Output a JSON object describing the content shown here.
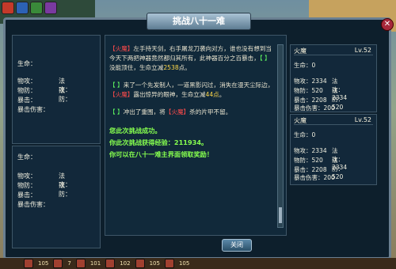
{
  "dialog": {
    "title": "挑战八十一难",
    "close_button": "关闭"
  },
  "left_panels": [
    {
      "hp_label": "生命：",
      "rows": [
        [
          "物攻：",
          "法攻："
        ],
        [
          "物防：",
          "法防："
        ],
        [
          "暴击：",
          ""
        ],
        [
          "暴击伤害：",
          ""
        ]
      ]
    },
    {
      "hp_label": "生命：",
      "rows": [
        [
          "物攻：",
          "法攻："
        ],
        [
          "物防：",
          "法防："
        ],
        [
          "暴击：",
          ""
        ],
        [
          "暴击伤害：",
          ""
        ]
      ]
    }
  ],
  "right_panels": [
    {
      "name": "火魔",
      "level": "Lv.52",
      "hp": "生命：0",
      "patk": "物攻：2334",
      "matk": "法攻：2334",
      "pdef": "物防：520",
      "mdef": "法防：520",
      "crit": "暴击：2208",
      "critdmg": "暴击伤害：200"
    },
    {
      "name": "火魔",
      "level": "Lv.52",
      "hp": "生命：0",
      "patk": "物攻：2334",
      "matk": "法攻：2334",
      "pdef": "物防：520",
      "mdef": "法防：520",
      "crit": "暴击：2208",
      "critdmg": "暴击伤害：200"
    }
  ],
  "battle_log": {
    "p1_a": "【火魔】",
    "p1_b": "左手持天剑，右手屠龙刀袭向对方，谁也没有想到当今天下两把神器竟然都归其所有，此神器百分之百暴击，",
    "p1_c": "【          】",
    "p1_d": "没能顶住，生命立减",
    "p1_e": "2538",
    "p1_f": "点。",
    "p2_a": "【          】",
    "p2_b": "来了一个先发制人，一道黑影闪过，消失在漫天尘际边，",
    "p2_c": "【火魔】",
    "p2_d": "露出惊异的眼神，生命立减",
    "p2_e": "44点",
    "p2_f": "。",
    "p3_a": "【          】",
    "p3_b": "冲出了重围，将",
    "p3_c": "【火魔】",
    "p3_d": "杀的片甲不留。",
    "result1": "您此次挑战成功。",
    "result2": "你此次挑战获得经验：211934。",
    "result3": "你可以在八十一难主界面领取奖励！"
  },
  "bottom_bar": [
    "105",
    "7",
    "101",
    "102",
    "105",
    "105"
  ]
}
